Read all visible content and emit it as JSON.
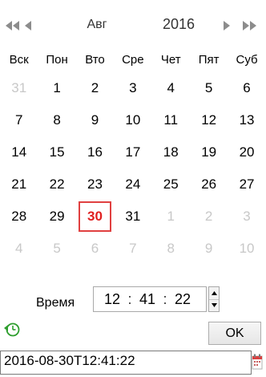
{
  "header": {
    "month": "Авг",
    "year": "2016"
  },
  "weekdays": [
    "Вск",
    "Пон",
    "Вто",
    "Сре",
    "Чет",
    "Пят",
    "Суб"
  ],
  "weeks": [
    [
      {
        "d": "31",
        "other": true
      },
      {
        "d": "1"
      },
      {
        "d": "2"
      },
      {
        "d": "3"
      },
      {
        "d": "4"
      },
      {
        "d": "5"
      },
      {
        "d": "6"
      }
    ],
    [
      {
        "d": "7"
      },
      {
        "d": "8"
      },
      {
        "d": "9"
      },
      {
        "d": "10"
      },
      {
        "d": "11"
      },
      {
        "d": "12"
      },
      {
        "d": "13"
      }
    ],
    [
      {
        "d": "14"
      },
      {
        "d": "15"
      },
      {
        "d": "16"
      },
      {
        "d": "17"
      },
      {
        "d": "18"
      },
      {
        "d": "19"
      },
      {
        "d": "20"
      }
    ],
    [
      {
        "d": "21"
      },
      {
        "d": "22"
      },
      {
        "d": "23"
      },
      {
        "d": "24"
      },
      {
        "d": "25"
      },
      {
        "d": "26"
      },
      {
        "d": "27"
      }
    ],
    [
      {
        "d": "28"
      },
      {
        "d": "29"
      },
      {
        "d": "30",
        "selected": true
      },
      {
        "d": "31"
      },
      {
        "d": "1",
        "other": true
      },
      {
        "d": "2",
        "other": true
      },
      {
        "d": "3",
        "other": true
      }
    ],
    [
      {
        "d": "4",
        "other": true
      },
      {
        "d": "5",
        "other": true
      },
      {
        "d": "6",
        "other": true
      },
      {
        "d": "7",
        "other": true
      },
      {
        "d": "8",
        "other": true
      },
      {
        "d": "9",
        "other": true
      },
      {
        "d": "10",
        "other": true
      }
    ]
  ],
  "time": {
    "label": "Время",
    "hours": "12",
    "minutes": "41",
    "seconds": "22",
    "separator": ":"
  },
  "footer": {
    "ok_label": "OK"
  },
  "date_field": {
    "value": "2016-08-30T12:41:22"
  },
  "colors": {
    "selected_border": "#e04040",
    "selected_text": "#e02020",
    "other_month_text": "#c8c8c8",
    "nav_arrow": "#8c8c8c",
    "today_icon": "#2e9e2e"
  },
  "icons": {
    "prev_year": "double-left-arrow-icon",
    "prev_month": "left-arrow-icon",
    "next_month": "right-arrow-icon",
    "next_year": "double-right-arrow-icon",
    "today": "today-clock-icon",
    "calendar": "calendar-icon"
  }
}
